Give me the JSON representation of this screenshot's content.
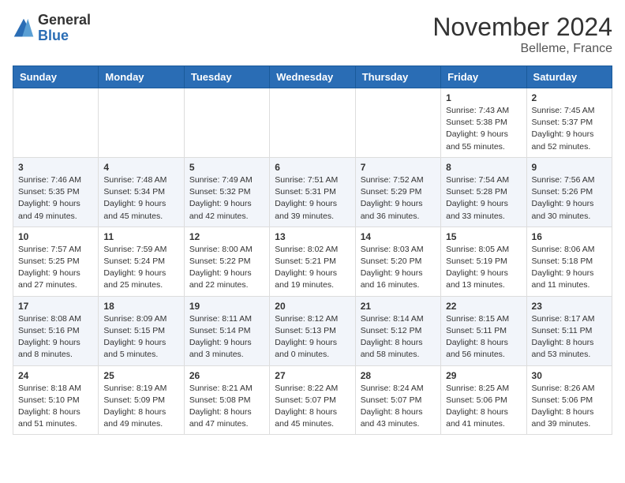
{
  "header": {
    "logo": {
      "general": "General",
      "blue": "Blue"
    },
    "month": "November 2024",
    "location": "Belleme, France"
  },
  "weekdays": [
    "Sunday",
    "Monday",
    "Tuesday",
    "Wednesday",
    "Thursday",
    "Friday",
    "Saturday"
  ],
  "weeks": [
    [
      {
        "day": "",
        "info": ""
      },
      {
        "day": "",
        "info": ""
      },
      {
        "day": "",
        "info": ""
      },
      {
        "day": "",
        "info": ""
      },
      {
        "day": "",
        "info": ""
      },
      {
        "day": "1",
        "info": "Sunrise: 7:43 AM\nSunset: 5:38 PM\nDaylight: 9 hours and 55 minutes."
      },
      {
        "day": "2",
        "info": "Sunrise: 7:45 AM\nSunset: 5:37 PM\nDaylight: 9 hours and 52 minutes."
      }
    ],
    [
      {
        "day": "3",
        "info": "Sunrise: 7:46 AM\nSunset: 5:35 PM\nDaylight: 9 hours and 49 minutes."
      },
      {
        "day": "4",
        "info": "Sunrise: 7:48 AM\nSunset: 5:34 PM\nDaylight: 9 hours and 45 minutes."
      },
      {
        "day": "5",
        "info": "Sunrise: 7:49 AM\nSunset: 5:32 PM\nDaylight: 9 hours and 42 minutes."
      },
      {
        "day": "6",
        "info": "Sunrise: 7:51 AM\nSunset: 5:31 PM\nDaylight: 9 hours and 39 minutes."
      },
      {
        "day": "7",
        "info": "Sunrise: 7:52 AM\nSunset: 5:29 PM\nDaylight: 9 hours and 36 minutes."
      },
      {
        "day": "8",
        "info": "Sunrise: 7:54 AM\nSunset: 5:28 PM\nDaylight: 9 hours and 33 minutes."
      },
      {
        "day": "9",
        "info": "Sunrise: 7:56 AM\nSunset: 5:26 PM\nDaylight: 9 hours and 30 minutes."
      }
    ],
    [
      {
        "day": "10",
        "info": "Sunrise: 7:57 AM\nSunset: 5:25 PM\nDaylight: 9 hours and 27 minutes."
      },
      {
        "day": "11",
        "info": "Sunrise: 7:59 AM\nSunset: 5:24 PM\nDaylight: 9 hours and 25 minutes."
      },
      {
        "day": "12",
        "info": "Sunrise: 8:00 AM\nSunset: 5:22 PM\nDaylight: 9 hours and 22 minutes."
      },
      {
        "day": "13",
        "info": "Sunrise: 8:02 AM\nSunset: 5:21 PM\nDaylight: 9 hours and 19 minutes."
      },
      {
        "day": "14",
        "info": "Sunrise: 8:03 AM\nSunset: 5:20 PM\nDaylight: 9 hours and 16 minutes."
      },
      {
        "day": "15",
        "info": "Sunrise: 8:05 AM\nSunset: 5:19 PM\nDaylight: 9 hours and 13 minutes."
      },
      {
        "day": "16",
        "info": "Sunrise: 8:06 AM\nSunset: 5:18 PM\nDaylight: 9 hours and 11 minutes."
      }
    ],
    [
      {
        "day": "17",
        "info": "Sunrise: 8:08 AM\nSunset: 5:16 PM\nDaylight: 9 hours and 8 minutes."
      },
      {
        "day": "18",
        "info": "Sunrise: 8:09 AM\nSunset: 5:15 PM\nDaylight: 9 hours and 5 minutes."
      },
      {
        "day": "19",
        "info": "Sunrise: 8:11 AM\nSunset: 5:14 PM\nDaylight: 9 hours and 3 minutes."
      },
      {
        "day": "20",
        "info": "Sunrise: 8:12 AM\nSunset: 5:13 PM\nDaylight: 9 hours and 0 minutes."
      },
      {
        "day": "21",
        "info": "Sunrise: 8:14 AM\nSunset: 5:12 PM\nDaylight: 8 hours and 58 minutes."
      },
      {
        "day": "22",
        "info": "Sunrise: 8:15 AM\nSunset: 5:11 PM\nDaylight: 8 hours and 56 minutes."
      },
      {
        "day": "23",
        "info": "Sunrise: 8:17 AM\nSunset: 5:11 PM\nDaylight: 8 hours and 53 minutes."
      }
    ],
    [
      {
        "day": "24",
        "info": "Sunrise: 8:18 AM\nSunset: 5:10 PM\nDaylight: 8 hours and 51 minutes."
      },
      {
        "day": "25",
        "info": "Sunrise: 8:19 AM\nSunset: 5:09 PM\nDaylight: 8 hours and 49 minutes."
      },
      {
        "day": "26",
        "info": "Sunrise: 8:21 AM\nSunset: 5:08 PM\nDaylight: 8 hours and 47 minutes."
      },
      {
        "day": "27",
        "info": "Sunrise: 8:22 AM\nSunset: 5:07 PM\nDaylight: 8 hours and 45 minutes."
      },
      {
        "day": "28",
        "info": "Sunrise: 8:24 AM\nSunset: 5:07 PM\nDaylight: 8 hours and 43 minutes."
      },
      {
        "day": "29",
        "info": "Sunrise: 8:25 AM\nSunset: 5:06 PM\nDaylight: 8 hours and 41 minutes."
      },
      {
        "day": "30",
        "info": "Sunrise: 8:26 AM\nSunset: 5:06 PM\nDaylight: 8 hours and 39 minutes."
      }
    ]
  ]
}
